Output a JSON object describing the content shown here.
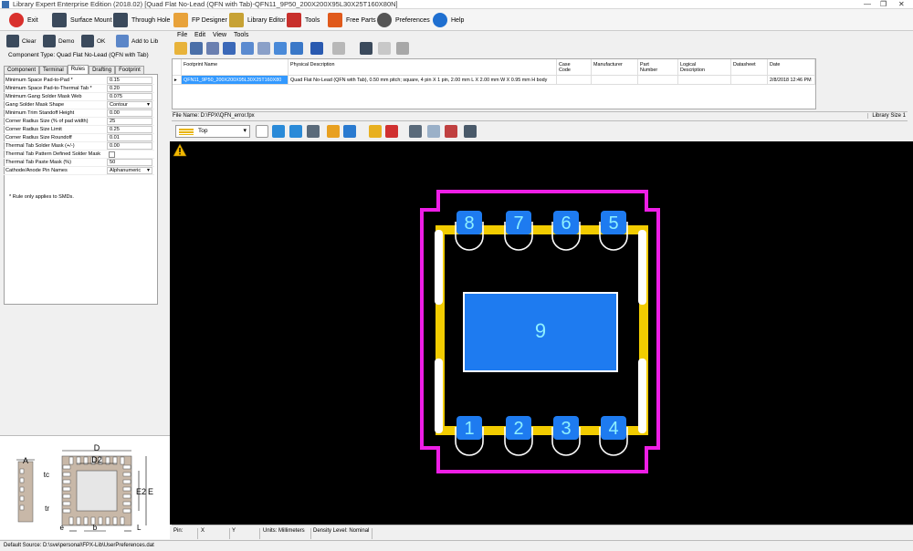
{
  "window": {
    "title": "Library Expert Enterprise Edition (2018.02) [Quad Flat No-Lead (QFN with Tab)-QFN11_9P50_200X200X95L30X25T160X80N]",
    "controls": [
      "—",
      "❐",
      "✕"
    ]
  },
  "main_toolbar": [
    {
      "label": "Exit",
      "icon": "power-icon",
      "color": "#d9302c"
    },
    {
      "label": "Surface Mount",
      "icon": "chip-icon",
      "color": "#3b4a5c"
    },
    {
      "label": "Through Hole",
      "icon": "through-hole-icon",
      "color": "#3b4a5c"
    },
    {
      "label": "FP Designer",
      "icon": "fp-designer-icon",
      "color": "#e8a23a"
    },
    {
      "label": "Library Editor",
      "icon": "books-icon",
      "color": "#c7a235"
    },
    {
      "label": "Tools",
      "icon": "toolbox-icon",
      "color": "#c8302c"
    },
    {
      "label": "Free Parts",
      "icon": "cart-icon",
      "color": "#e05a1c"
    },
    {
      "label": "Preferences",
      "icon": "gear-icon",
      "color": "#555555"
    },
    {
      "label": "Help",
      "icon": "help-icon",
      "color": "#1f6fd0"
    }
  ],
  "left_toolbar": [
    {
      "label": "Clear",
      "icon": "clear-icon"
    },
    {
      "label": "Demo",
      "icon": "demo-icon"
    },
    {
      "label": "OK",
      "icon": "ok-icon"
    },
    {
      "label": "Add to Lib",
      "icon": "add-to-lib-icon"
    }
  ],
  "component_type": "Component Type: Quad Flat No-Lead (QFN with Tab)",
  "left_tabs": [
    "Component",
    "Terminal",
    "Rules",
    "Drafting",
    "Footprint"
  ],
  "active_tab": "Rules",
  "rules": [
    {
      "label": "Minimum Space Pad-to-Pad *",
      "value": "0.15",
      "kind": "text"
    },
    {
      "label": "Minimum Space Pad-to-Thermal Tab *",
      "value": "0.20",
      "kind": "text"
    },
    {
      "label": "Minimum Gang Solder Mask Web",
      "value": "0.075",
      "kind": "text"
    },
    {
      "label": "Gang Solder Mask Shape",
      "value": "Contour",
      "kind": "dropdown"
    },
    {
      "label": "Minimum Trim Standoff Height",
      "value": "0.00",
      "kind": "text"
    },
    {
      "label": "Corner Radius Size (% of pad width)",
      "value": "25",
      "kind": "text"
    },
    {
      "label": "Corner Radius Size Limit",
      "value": "0.25",
      "kind": "text"
    },
    {
      "label": "Corner Radius Size Roundoff",
      "value": "0.01",
      "kind": "text"
    },
    {
      "label": "Thermal Tab Solder Mask (+/-)",
      "value": "0.00",
      "kind": "text"
    },
    {
      "label": "Thermal Tab Pattern Defined Solder Mask",
      "value": "",
      "kind": "checkbox"
    },
    {
      "label": "Thermal Tab Paste Mask (%)",
      "value": "50",
      "kind": "text"
    },
    {
      "label": "Cathode/Anode Pin Names",
      "value": "Alphanumeric",
      "kind": "dropdown"
    }
  ],
  "rules_note": "* Rule only applies to SMDs.",
  "diagram_labels": {
    "A": "A",
    "D": "D",
    "D2": "D2",
    "tc": "tc",
    "tr": "tr",
    "E2": "E2",
    "E": "E",
    "e": "e",
    "b": "b",
    "L": "L"
  },
  "menu": [
    "File",
    "Edit",
    "View",
    "Tools"
  ],
  "grid": {
    "columns": [
      "Footprint Name",
      "Physical Description",
      "Case\nCode",
      "Manufacturer",
      "Part\nNumber",
      "Logical\nDescription",
      "Datasheet",
      "Date"
    ],
    "row": {
      "footprint": "QFN11_9P50_200X200X95L30X25T160X80",
      "description": "Quad Flat No-Lead (QFN with Tab), 0.50 mm pitch; square, 4 pin X 1 pin, 2.00 mm L X 2.00 mm W X 0.95 mm H body",
      "case_code": "",
      "manufacturer": "",
      "part_number": "",
      "logical": "",
      "datasheet": "",
      "date": "2/8/2018 12:46 PM"
    }
  },
  "file_name": "File Name:  D:\\FPX\\QFN_error.fpx",
  "library_size": "Library Size   1",
  "layer": {
    "value": "Top"
  },
  "pads_top": [
    "8",
    "7",
    "6",
    "5"
  ],
  "pads_bottom": [
    "1",
    "2",
    "3",
    "4"
  ],
  "thermal_pad": "9",
  "colors": {
    "pad": "#1e7bf0",
    "silk": "#f2cc00",
    "courtyard": "#ee1ee6",
    "outline": "#ffffff",
    "background": "#000000"
  },
  "status": {
    "pin": "Pin:",
    "x": "X",
    "y": "Y",
    "units": "Units: Millimeters",
    "density": "Density Level: Nominal"
  },
  "default_source": "Default Source:  D:\\sve\\personal\\FPX-Lib\\UserPreferences.dat"
}
